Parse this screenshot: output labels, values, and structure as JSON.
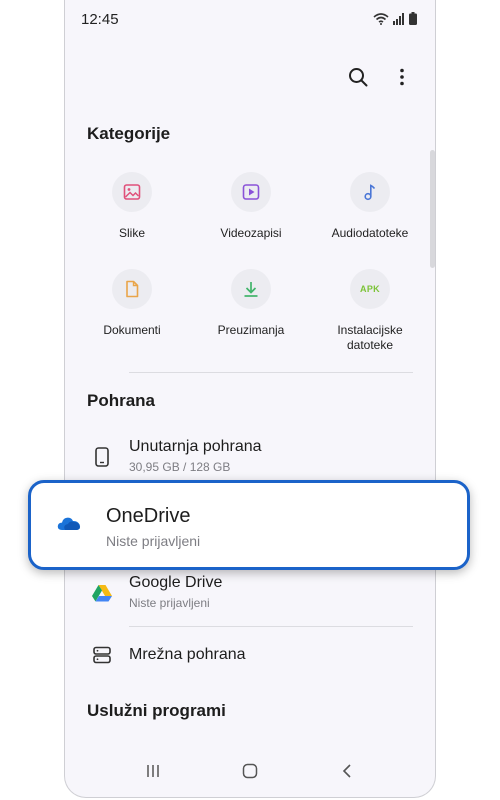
{
  "status": {
    "time": "12:45"
  },
  "categories": {
    "title": "Kategorije",
    "items": [
      {
        "label": "Slike",
        "icon": "image-icon",
        "color": "#e0507a"
      },
      {
        "label": "Videozapisi",
        "icon": "video-icon",
        "color": "#8a52d8"
      },
      {
        "label": "Audiodatoteke",
        "icon": "music-note-icon",
        "color": "#4a76d6"
      },
      {
        "label": "Dokumenti",
        "icon": "document-icon",
        "color": "#e9a54a"
      },
      {
        "label": "Preuzimanja",
        "icon": "download-icon",
        "color": "#40b46a"
      },
      {
        "label": "Instalacijske datoteke",
        "icon": "apk-icon",
        "icon_text": "APK",
        "color": "#7cc338"
      }
    ]
  },
  "storage": {
    "title": "Pohrana",
    "items": [
      {
        "title": "Unutarnja pohrana",
        "subtitle": "30,95 GB / 128 GB",
        "icon": "phone-icon"
      },
      {
        "title": "OneDrive",
        "subtitle": "Niste prijavljeni",
        "icon": "onedrive-cloud-icon",
        "highlighted": true
      },
      {
        "title": "Google Drive",
        "subtitle": "Niste prijavljeni",
        "icon": "google-drive-icon"
      },
      {
        "title": "Mrežna pohrana",
        "icon": "network-storage-icon"
      }
    ]
  },
  "utilities": {
    "title": "Uslužni programi"
  },
  "colors": {
    "accent": "#1b63c9",
    "onedrive": "#1a73d9"
  }
}
